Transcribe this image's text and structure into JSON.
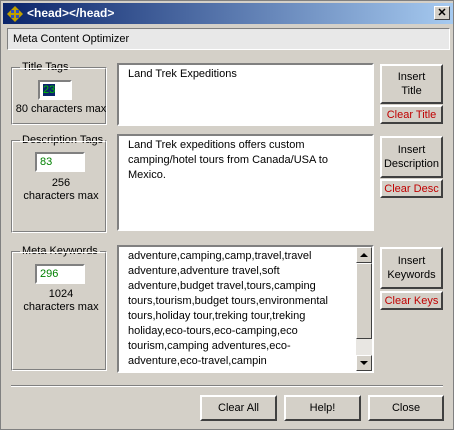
{
  "window": {
    "title": "<head></head>",
    "close_glyph": "✕"
  },
  "header": {
    "label": "Meta Content Optimizer"
  },
  "title_tags": {
    "legend": "Title Tags",
    "count": "23",
    "max_label": "80 characters max",
    "text": "Land Trek Expeditions",
    "insert_label": "Insert Title",
    "clear_label": "Clear Title"
  },
  "description_tags": {
    "legend": "Description Tags",
    "count": "83",
    "max_line1": "256",
    "max_line2": "characters max",
    "text": "Land Trek expeditions offers custom camping/hotel tours from Canada/USA  to Mexico.",
    "insert_label": "Insert Description",
    "clear_label": "Clear Desc"
  },
  "meta_keywords": {
    "legend": "Meta Keywords",
    "count": "296",
    "max_line1": "1024",
    "max_line2": "characters max",
    "text": "adventure,camping,camp,travel,travel adventure,adventure travel,soft adventure,budget travel,tours,camping tours,tourism,budget tours,environmental tours,holiday tour,treking tour,treking holiday,eco-tours,eco-camping,eco tourism,camping adventures,eco-adventure,eco-travel,campin",
    "insert_label": "Insert Keywords",
    "clear_label": "Clear Keys"
  },
  "footer": {
    "clear_all_label": "Clear All",
    "help_label": "Help!",
    "close_label": "Close"
  },
  "colors": {
    "titlebar_start": "#0a246a",
    "titlebar_end": "#a6caf0",
    "count_text": "#008000",
    "clear_button_text": "#c00000"
  },
  "icons": {
    "window": "diamond-app-icon",
    "close": "close-icon",
    "scroll_up": "scroll-up-arrow-icon",
    "scroll_down": "scroll-down-arrow-icon"
  }
}
